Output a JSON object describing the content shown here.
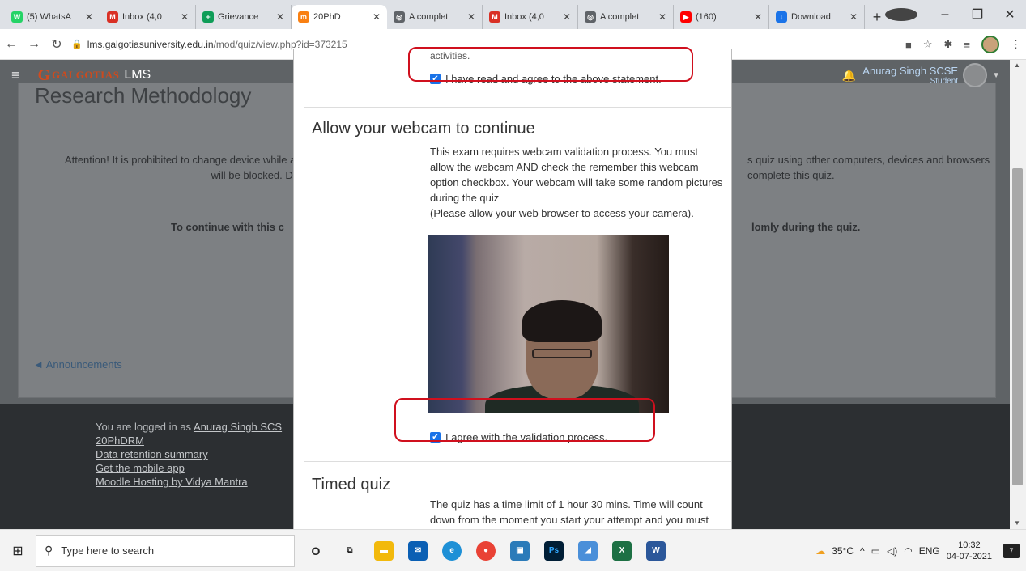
{
  "browser": {
    "tabs": [
      {
        "title": "(5) WhatsA",
        "icon": "whatsapp-icon",
        "color": "#25d366",
        "glyph": "W"
      },
      {
        "title": "Inbox (4,0",
        "icon": "gmail-icon",
        "color": "#d93025",
        "glyph": "M"
      },
      {
        "title": "Grievance",
        "icon": "sheets-icon",
        "color": "#0f9d58",
        "glyph": "+"
      },
      {
        "title": "20PhD",
        "icon": "moodle-icon",
        "color": "#f98012",
        "glyph": "m",
        "active": true
      },
      {
        "title": "A complet",
        "icon": "globe-icon",
        "color": "#5f6368",
        "glyph": "◎"
      },
      {
        "title": "Inbox (4,0",
        "icon": "gmail-icon",
        "color": "#d93025",
        "glyph": "M"
      },
      {
        "title": "A complet",
        "icon": "globe-icon",
        "color": "#5f6368",
        "glyph": "◎"
      },
      {
        "title": "(160)",
        "icon": "youtube-icon",
        "color": "#ff0000",
        "glyph": "▶"
      },
      {
        "title": "Download",
        "icon": "download-icon",
        "color": "#1a73e8",
        "glyph": "↓"
      }
    ],
    "url_host": "lms.galgotiasuniversity.edu.in",
    "url_path": "/mod/quiz/view.php?id=373215"
  },
  "lms": {
    "logo_main": "GALGOTIAS",
    "logo_sub": "UNIVERSITY",
    "logo_lms": "LMS",
    "user_name": "Anurag Singh SCSE",
    "user_role": "Student",
    "course_title": "Research Methodology",
    "attention_left": "Attention! It is prohibited to change device while at",
    "attention_left2": "will be blocked. Do",
    "attention_right": "s quiz using other computers, devices and browsers",
    "attention_right2": "complete this quiz.",
    "bold_left": "To continue with this c",
    "bold_right": "lomly during the quiz.",
    "announcements": "Announcements"
  },
  "footer": {
    "logged_in_prefix": "You are logged in as ",
    "logged_in_user": "Anurag Singh SCS",
    "course_short": "20PhDRM",
    "data_retention": "Data retention summary",
    "mobile_app": "Get the mobile app",
    "hosting": "Moodle Hosting by Vidya Mantra"
  },
  "modal": {
    "cut_text": "activities.",
    "agree_statement": "I have read and agree to the above statement.",
    "webcam_title": "Allow your webcam to continue",
    "webcam_body": "This exam requires webcam validation process. You must allow the webcam AND check the remember this webcam option checkbox. Your webcam will take some random pictures during the quiz",
    "webcam_note": "(Please allow your web browser to access your camera).",
    "agree_validation": "I agree with the validation process.",
    "timed_title": "Timed quiz",
    "timed_body": "The quiz has a time limit of 1 hour 30 mins. Time will count down from the moment you start your attempt and you must submit before it expires. Are you sure that you wish to"
  },
  "taskbar": {
    "search_placeholder": "Type here to search",
    "temperature": "35°C",
    "language": "ENG",
    "time": "10:32",
    "date": "04-07-2021",
    "notifications": "7"
  },
  "colors": {
    "annotation": "#d0101e",
    "checkbox": "#1a73e8"
  }
}
